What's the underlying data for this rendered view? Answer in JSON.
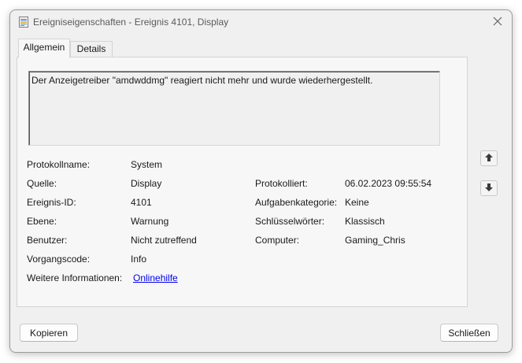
{
  "window": {
    "title": "Ereigniseigenschaften - Ereignis 4101, Display",
    "icon": "event-properties-icon",
    "close_icon": "close-icon"
  },
  "tabs": [
    {
      "label": "Allgemein",
      "active": true
    },
    {
      "label": "Details",
      "active": false
    }
  ],
  "general": {
    "description": "Der Anzeigetreiber \"amdwddmg\" reagiert nicht mehr und wurde wiederhergestellt.",
    "fields": {
      "protokollname": {
        "label": "Protokollname:",
        "value": "System"
      },
      "quelle": {
        "label": "Quelle:",
        "value": "Display"
      },
      "protokolliert": {
        "label": "Protokolliert:",
        "value": "06.02.2023 09:55:54"
      },
      "ereignis_id": {
        "label": "Ereignis-ID:",
        "value": "4101"
      },
      "aufgabenkategorie": {
        "label": "Aufgabenkategorie:",
        "value": "Keine"
      },
      "ebene": {
        "label": "Ebene:",
        "value": "Warnung"
      },
      "schluesselwoerter": {
        "label": "Schlüsselwörter:",
        "value": "Klassisch"
      },
      "benutzer": {
        "label": "Benutzer:",
        "value": "Nicht zutreffend"
      },
      "computer": {
        "label": "Computer:",
        "value": "Gaming_Chris"
      },
      "vorgangscode": {
        "label": "Vorgangscode:",
        "value": "Info"
      },
      "weitere_informationen": {
        "label": "Weitere Informationen:",
        "value": "Onlinehilfe"
      }
    }
  },
  "navigation": {
    "up_icon": "arrow-up-icon",
    "down_icon": "arrow-down-icon"
  },
  "buttons": {
    "copy": "Kopieren",
    "close": "Schließen"
  }
}
